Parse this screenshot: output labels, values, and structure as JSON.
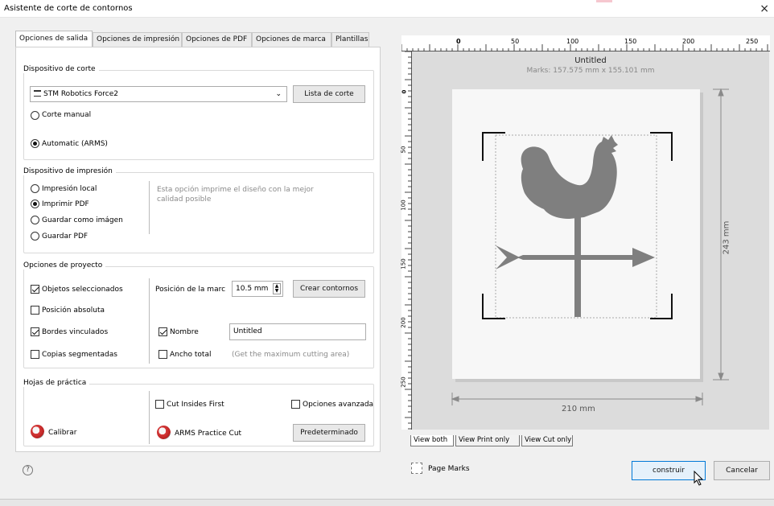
{
  "window": {
    "title": "Asistente de corte de contornos",
    "close": "×"
  },
  "tabs": [
    "Opciones de salida",
    "Opciones de impresión",
    "Opciones de PDF",
    "Opciones de marca",
    "Plantillas"
  ],
  "cut_device": {
    "label": "Dispositivo de corte",
    "selected": "STM Robotics Force2",
    "list_button": "Lista de corte",
    "manual": "Corte manual",
    "automatic": "Automatic (ARMS)"
  },
  "print_device": {
    "label": "Dispositivo de impresión",
    "local": "Impresión local",
    "pdf": "Imprimir PDF",
    "save_image": "Guardar como imágen",
    "save_pdf": "Guardar PDF",
    "description": "Esta opción imprime el diseño con la mejor calidad posible"
  },
  "project": {
    "label": "Opciones de proyecto",
    "selected_objects": "Objetos seleccionados",
    "absolute_position": "Posición absoluta",
    "linked_edges": "Bordes vinculados",
    "segmented_copies": "Copias segmentadas",
    "mark_position_label": "Posición de la marc",
    "mark_position_value": "10.5 mm",
    "create_contours": "Crear contornos",
    "name_label": "Nombre",
    "name_value": "Untitled",
    "total_width": "Ancho total",
    "total_width_hint": "(Get the maximum cutting area)"
  },
  "practice": {
    "label": "Hojas de práctica",
    "cut_insides": "Cut Insides First",
    "advanced": "Opciones avanzadas",
    "calibrate": "Calibrar",
    "arms_practice": "ARMS Practice Cut",
    "default_button": "Predeterminado"
  },
  "preview": {
    "title": "Untitled",
    "marks": "Marks: 157.575 mm x 155.101 mm",
    "width_dim": "210 mm",
    "height_dim": "243 mm",
    "ruler_h": [
      "0",
      "50",
      "100",
      "150",
      "200",
      "250"
    ],
    "ruler_v": [
      "0",
      "50",
      "100",
      "150",
      "200",
      "250"
    ],
    "view_tabs": [
      "View both",
      "View Print only",
      "View Cut only"
    ]
  },
  "footer": {
    "help": "?",
    "page_marks": "Page Marks",
    "build": "construir",
    "cancel": "Cancelar"
  },
  "colors": {
    "silhouette": "#7f7f7f",
    "paper": "#f7f7f7",
    "canvas": "#dcdcdc",
    "accent": "#0078d7"
  }
}
